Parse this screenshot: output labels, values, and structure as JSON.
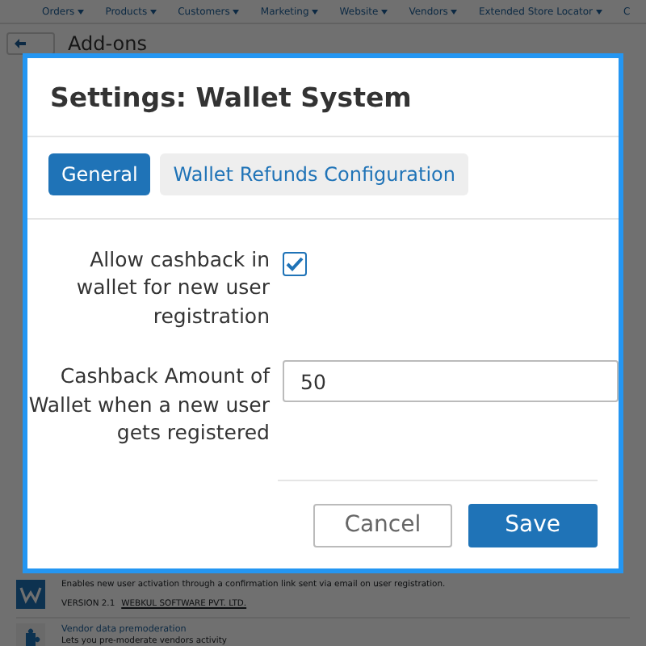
{
  "top_nav": {
    "items": [
      "Orders",
      "Products",
      "Customers",
      "Marketing",
      "Website",
      "Vendors",
      "Extended Store Locator"
    ],
    "cut_item": "C"
  },
  "page_title": "Add-ons",
  "addons": [
    {
      "description": "Enables new user activation through a confirmation link sent via email on user registration.",
      "version": "VERSION 2.1",
      "developer": "WEBKUL SOFTWARE PVT. LTD."
    },
    {
      "title": "Vendor data premoderation",
      "description": "Lets you pre-moderate vendors activity"
    }
  ],
  "dialog": {
    "title": "Settings: Wallet System",
    "tabs": [
      {
        "label": "General",
        "selected": true
      },
      {
        "label": "Wallet Refunds Configuration",
        "selected": false
      }
    ],
    "fields": [
      {
        "kind": "checkbox",
        "label": "Allow cashback in wallet for new user registration",
        "checked": true
      },
      {
        "kind": "text",
        "label": "Cashback Amount of Wallet when a new user gets registered",
        "value": "50"
      }
    ],
    "buttons": [
      {
        "label": "Cancel",
        "kind": "secondary"
      },
      {
        "label": "Save",
        "kind": "primary"
      }
    ]
  }
}
